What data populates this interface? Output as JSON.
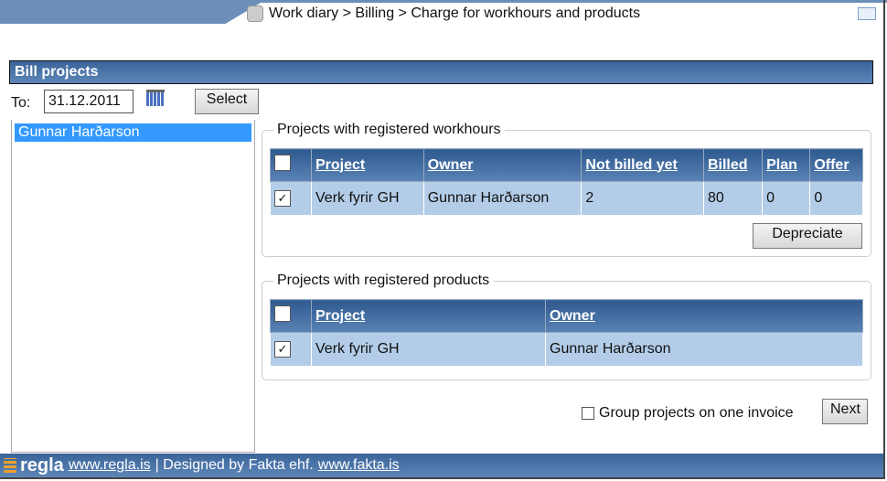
{
  "breadcrumb": "Work diary > Billing > Charge for workhours and products",
  "section_title": "Bill projects",
  "filter": {
    "to_label": "To:",
    "to_value": "31.12.2011",
    "select_label": "Select"
  },
  "people": [
    {
      "name": "Gunnar Harðarson",
      "selected": true
    }
  ],
  "workhours": {
    "legend": "Projects with registered workhours",
    "columns": [
      "Project",
      "Owner",
      "Not billed yet",
      "Billed",
      "Plan",
      "Offer"
    ],
    "rows": [
      {
        "checked": true,
        "project": "Verk fyrir GH",
        "owner": "Gunnar Harðarson",
        "not_billed": "2",
        "billed": "80",
        "plan": "0",
        "offer": "0"
      }
    ],
    "depreciate_label": "Depreciate"
  },
  "products": {
    "legend": "Projects with registered products",
    "columns": [
      "Project",
      "Owner"
    ],
    "rows": [
      {
        "checked": true,
        "project": "Verk fyrir GH",
        "owner": "Gunnar Harðarson"
      }
    ]
  },
  "group_label": "Group projects on one invoice",
  "group_checked": false,
  "next_label": "Next",
  "footer": {
    "logo": "regla",
    "link1": "www.regla.is",
    "text": "| Designed by Fakta ehf.",
    "link2": "www.fakta.is"
  },
  "colors": {
    "header": "#3a6499",
    "row": "#b3cde8",
    "selected": "#3399ff"
  }
}
